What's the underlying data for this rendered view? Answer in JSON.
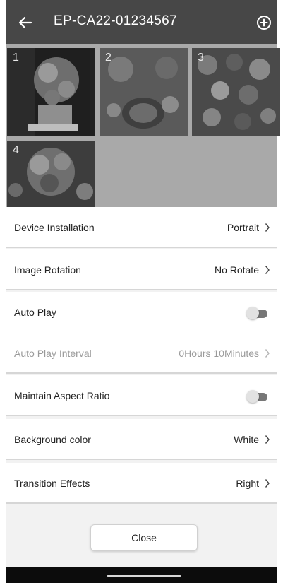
{
  "header": {
    "title": "EP-CA22-01234567",
    "back_icon": "arrow-left-icon",
    "add_icon": "plus-circle-icon",
    "background_color": "#474747"
  },
  "images": [
    {
      "number": "1"
    },
    {
      "number": "2"
    },
    {
      "number": "3"
    },
    {
      "number": "4"
    }
  ],
  "settings": [
    {
      "label": "Device Installation",
      "value": "Portrait",
      "kind": "select"
    },
    {
      "label": "Image Rotation",
      "value": "No Rotate",
      "kind": "select"
    },
    {
      "label": "Auto Play",
      "kind": "toggle",
      "on": false
    },
    {
      "label": "Auto Play Interval",
      "value": "0Hours 10Minutes",
      "kind": "select",
      "disabled": true
    },
    {
      "label": "Maintain Aspect Ratio",
      "kind": "toggle",
      "on": false
    },
    {
      "label": "Background color",
      "value": "White",
      "kind": "select"
    },
    {
      "label": "Transition Effects",
      "value": "Right",
      "kind": "select"
    }
  ],
  "footer": {
    "close_label": "Close"
  }
}
